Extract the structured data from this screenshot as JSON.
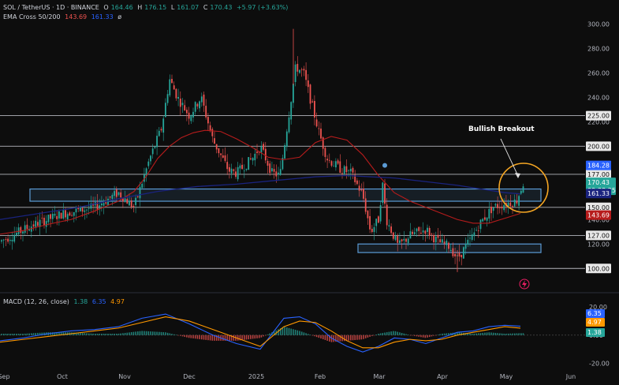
{
  "legend": {
    "symbol": "SOL / TetherUS · 1D · BINANCE",
    "o_label": "O",
    "o": "164.46",
    "h_label": "H",
    "h": "176.15",
    "l_label": "L",
    "l": "161.07",
    "c_label": "C",
    "c": "170.43",
    "change": "+5.97 (+3.63%)",
    "ema_title": "EMA Cross 50/200",
    "ema_fast": "143.69",
    "ema_slow": "161.33",
    "ema_extra": "ø",
    "macd_title": "MACD (12, 26, close)",
    "macd_hist": "1.38",
    "macd_line": "6.35",
    "macd_signal": "4.97"
  },
  "annotation": "Bullish Breakout",
  "price_tags": {
    "high_tag": "184.28",
    "last_price": "170.43",
    "countdown": "09:38:25",
    "ema_slow_tag": "161.33",
    "ema_fast_tag": "143.69"
  },
  "macd_tags": {
    "line": "6.35",
    "signal": "4.97",
    "hist": "1.38"
  },
  "colors": {
    "background": "#0d0d0d",
    "up": "#26a69a",
    "down": "#ef5350",
    "ema_fast": "#b71c1c",
    "ema_slow": "#1a237e",
    "zone": "#5b9bd5",
    "circle": "#f5a623",
    "macd": "#2962ff",
    "signal": "#ff9800",
    "level": "#d1d4dc"
  },
  "chart_data": {
    "type": "candlestick",
    "panes": [
      {
        "name": "price",
        "y_ticks": [
          100,
          120,
          140,
          160,
          180,
          200,
          220,
          240,
          260,
          280,
          300
        ],
        "ylim": [
          95,
          308
        ],
        "levels": [
          225,
          200,
          177,
          150,
          127,
          100
        ],
        "zones": [
          [
            155,
            165
          ],
          [
            113,
            120
          ]
        ],
        "series": [
          {
            "name": "EMA 50",
            "type": "line",
            "x": [
              0,
              30,
              60,
              90,
              120,
              150,
              170,
              185,
              200,
              215,
              230,
              245,
              260,
              280,
              300,
              320,
              340,
              360,
              380,
              400,
              420,
              440,
              460,
              480,
              500,
              520,
              540,
              560,
              580,
              600,
              620,
              640,
              660
            ],
            "values": [
              128,
              131,
              136,
              140,
              147,
              155,
              163,
              175,
              190,
              200,
              207,
              211,
              213,
              212,
              206,
              199,
              191,
              189,
              191,
              203,
              208,
              205,
              193,
              176,
              162,
              155,
              150,
              145,
              140,
              137,
              137,
              141,
              145
            ]
          },
          {
            "name": "EMA 200",
            "type": "line",
            "x": [
              0,
              50,
              100,
              150,
              200,
              250,
              300,
              350,
              400,
              440,
              470,
              500,
              540,
              580,
              620,
              640,
              660
            ],
            "values": [
              140,
              145,
              150,
              157,
              163,
              167,
              169,
              172,
              175,
              176,
              175,
              174,
              171,
              168,
              164,
              162,
              161
            ]
          }
        ]
      },
      {
        "name": "MACD (12, 26, close)",
        "y_ticks": [
          20,
          0,
          -20
        ],
        "ylim": [
          -22,
          24
        ],
        "series": [
          {
            "name": "MACD",
            "type": "line",
            "x": [
              0,
              30,
              60,
              90,
              120,
              150,
              180,
              210,
              240,
              270,
              300,
              330,
              360,
              380,
              400,
              420,
              440,
              460,
              480,
              500,
              520,
              540,
              560,
              580,
              600,
              620,
              640,
              660
            ],
            "values": [
              -4,
              -2,
              1,
              3,
              4,
              6,
              12,
              15,
              8,
              0,
              -6,
              -10,
              12,
              13,
              8,
              -2,
              -8,
              -12,
              -8,
              -2,
              -3,
              -6,
              -2,
              2,
              3,
              6,
              7,
              6.35
            ]
          },
          {
            "name": "Signal",
            "type": "line",
            "x": [
              0,
              30,
              60,
              90,
              120,
              150,
              180,
              210,
              240,
              270,
              300,
              330,
              360,
              380,
              400,
              420,
              440,
              460,
              480,
              500,
              520,
              540,
              560,
              580,
              600,
              620,
              640,
              660
            ],
            "values": [
              -5,
              -3,
              -1,
              1,
              3,
              5,
              9,
              13,
              10,
              4,
              -2,
              -8,
              6,
              10,
              9,
              3,
              -4,
              -9,
              -9,
              -5,
              -3,
              -4,
              -3,
              0,
              2,
              4,
              6,
              4.97
            ]
          }
        ]
      }
    ],
    "x_ticks": [
      "Sep",
      "Oct",
      "Nov",
      "Dec",
      "2025",
      "Feb",
      "Mar",
      "Apr",
      "May",
      "Jun"
    ]
  }
}
